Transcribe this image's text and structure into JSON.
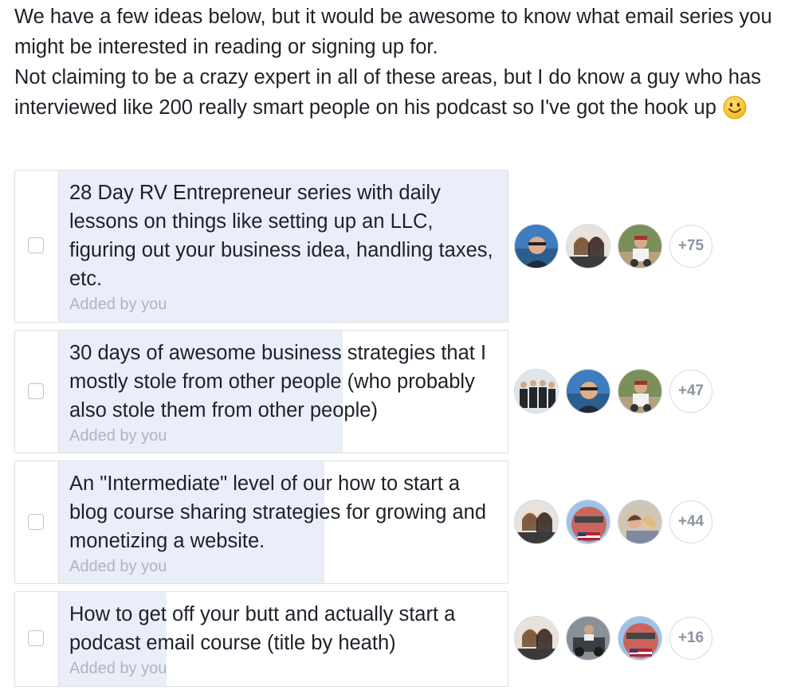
{
  "intro": {
    "line1": "We have a few ideas below, but it would be awesome to know what email series you might be interested in reading or signing up for.",
    "line2": "Not claiming to be a crazy expert in all of these areas, but I do know a guy who has interviewed like 200 really smart people on his podcast so I've got the hook up",
    "emoji": "smiley-face-emoji"
  },
  "poll": {
    "options": [
      {
        "label": "28 Day RV Entrepreneur series with daily lessons on things like setting up an LLC, figuring out your business idea, handling taxes, etc.",
        "added_by": "Added by you",
        "more_voters": "+75",
        "vote_share": 1.0,
        "checked": false
      },
      {
        "label": "30 days of awesome business strategies that I mostly stole from other people (who probably also stole them from other people)",
        "added_by": "Added by you",
        "more_voters": "+47",
        "vote_share": 0.63,
        "checked": false
      },
      {
        "label": "An \"Intermediate\" level of our how to start a blog course sharing strategies for growing and monetizing a website.",
        "added_by": "Added by you",
        "more_voters": "+44",
        "vote_share": 0.59,
        "checked": false
      },
      {
        "label": "How to get off your butt and actually start a podcast email course (title by heath)",
        "added_by": "Added by you",
        "more_voters": "+16",
        "vote_share": 0.24,
        "checked": false
      }
    ]
  },
  "colors": {
    "bar_fill": "#e9eef8",
    "border": "#dddfe2",
    "muted_text": "#b0b5bd",
    "text": "#1d2129"
  }
}
